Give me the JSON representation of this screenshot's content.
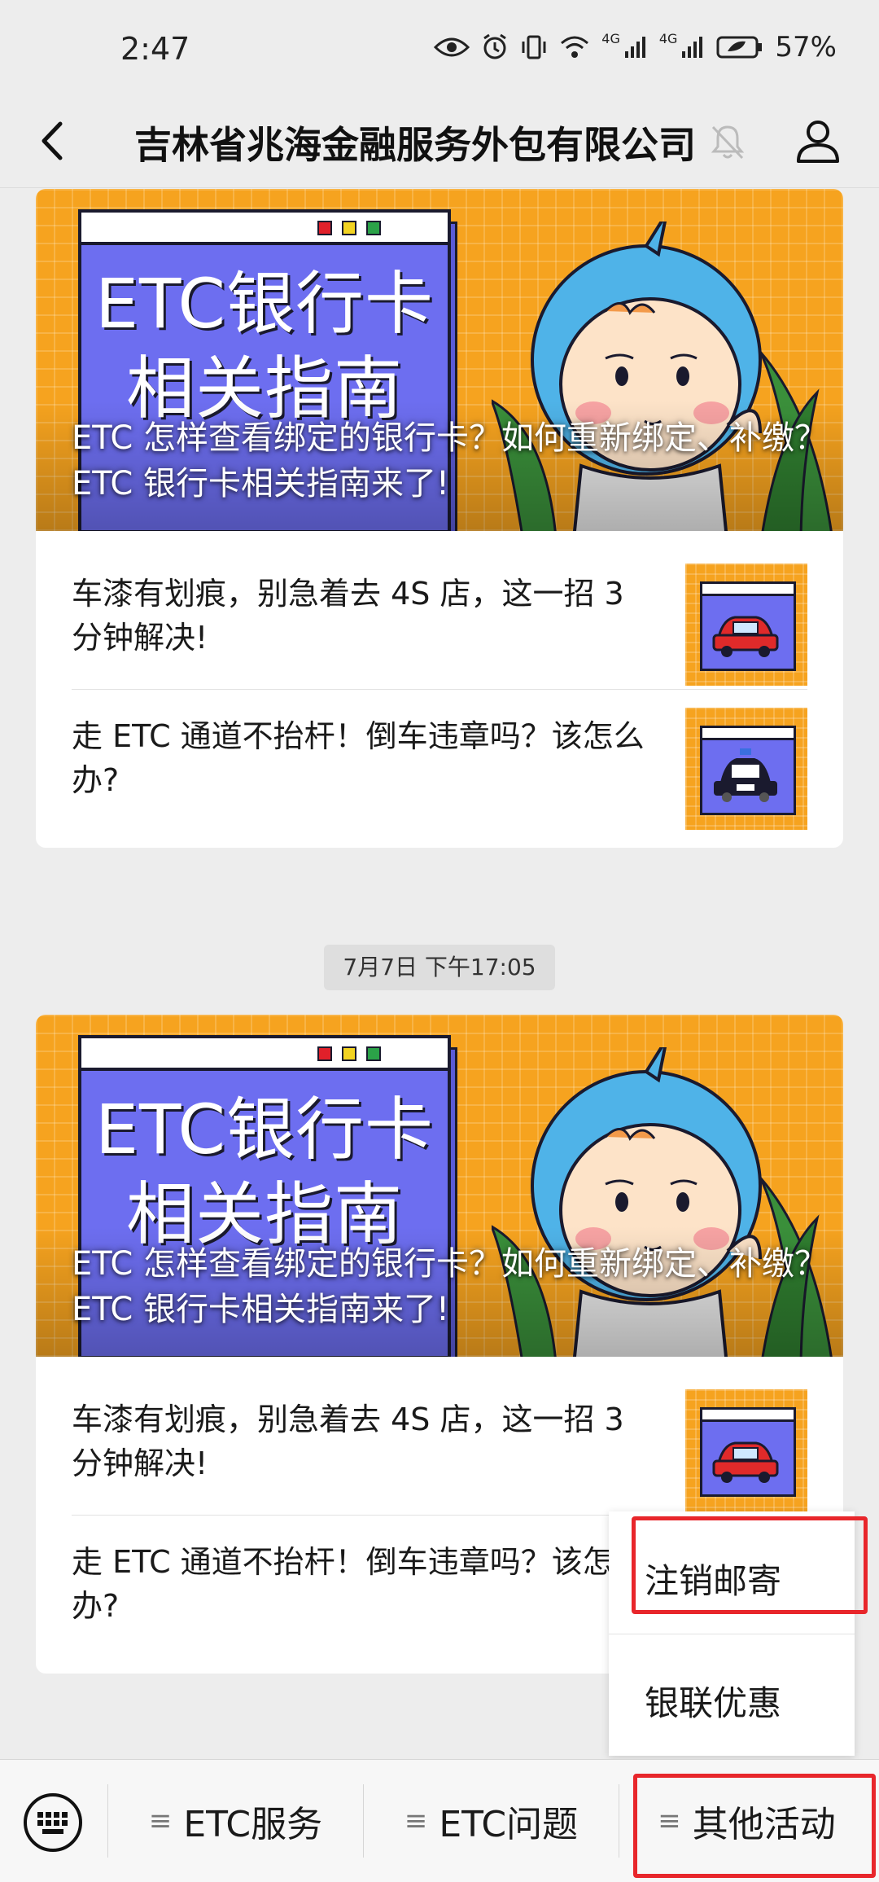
{
  "status_bar": {
    "time": "2:47",
    "network_1": "4G",
    "network_2": "4G",
    "battery": "57%"
  },
  "header": {
    "title": "吉林省兆海金融服务外包有限公司"
  },
  "feed": [
    {
      "banner": {
        "image_text_line1": "ETC银行卡",
        "image_text_line2": "相关指南",
        "title": "ETC 怎样查看绑定的银行卡？如何重新绑定、补缴？ETC 银行卡相关指南来了!"
      },
      "items": [
        {
          "text": "车漆有划痕，别急着去 4S 店，这一招 3 分钟解决!"
        },
        {
          "text": "走 ETC 通道不抬杆！倒车违章吗？该怎么办?"
        }
      ]
    },
    {
      "timestamp": "7月7日 下午17:05",
      "banner": {
        "image_text_line1": "ETC银行卡",
        "image_text_line2": "相关指南",
        "title": "ETC 怎样查看绑定的银行卡？如何重新绑定、补缴？ETC 银行卡相关指南来了!"
      },
      "items": [
        {
          "text": "车漆有划痕，别急着去 4S 店，这一招 3 分钟解决!"
        },
        {
          "text": "走 ETC 通道不抬杆！倒车违章吗？该怎么办?"
        }
      ]
    }
  ],
  "popup_menu": {
    "items": [
      "注销邮寄",
      "银联优惠"
    ]
  },
  "bottom_menu": {
    "items": [
      "ETC服务",
      "ETC问题",
      "其他活动"
    ]
  },
  "colors": {
    "banner_orange": "#f6a31f",
    "window_blue": "#6d6ef0",
    "highlight_red": "#e8262b"
  }
}
